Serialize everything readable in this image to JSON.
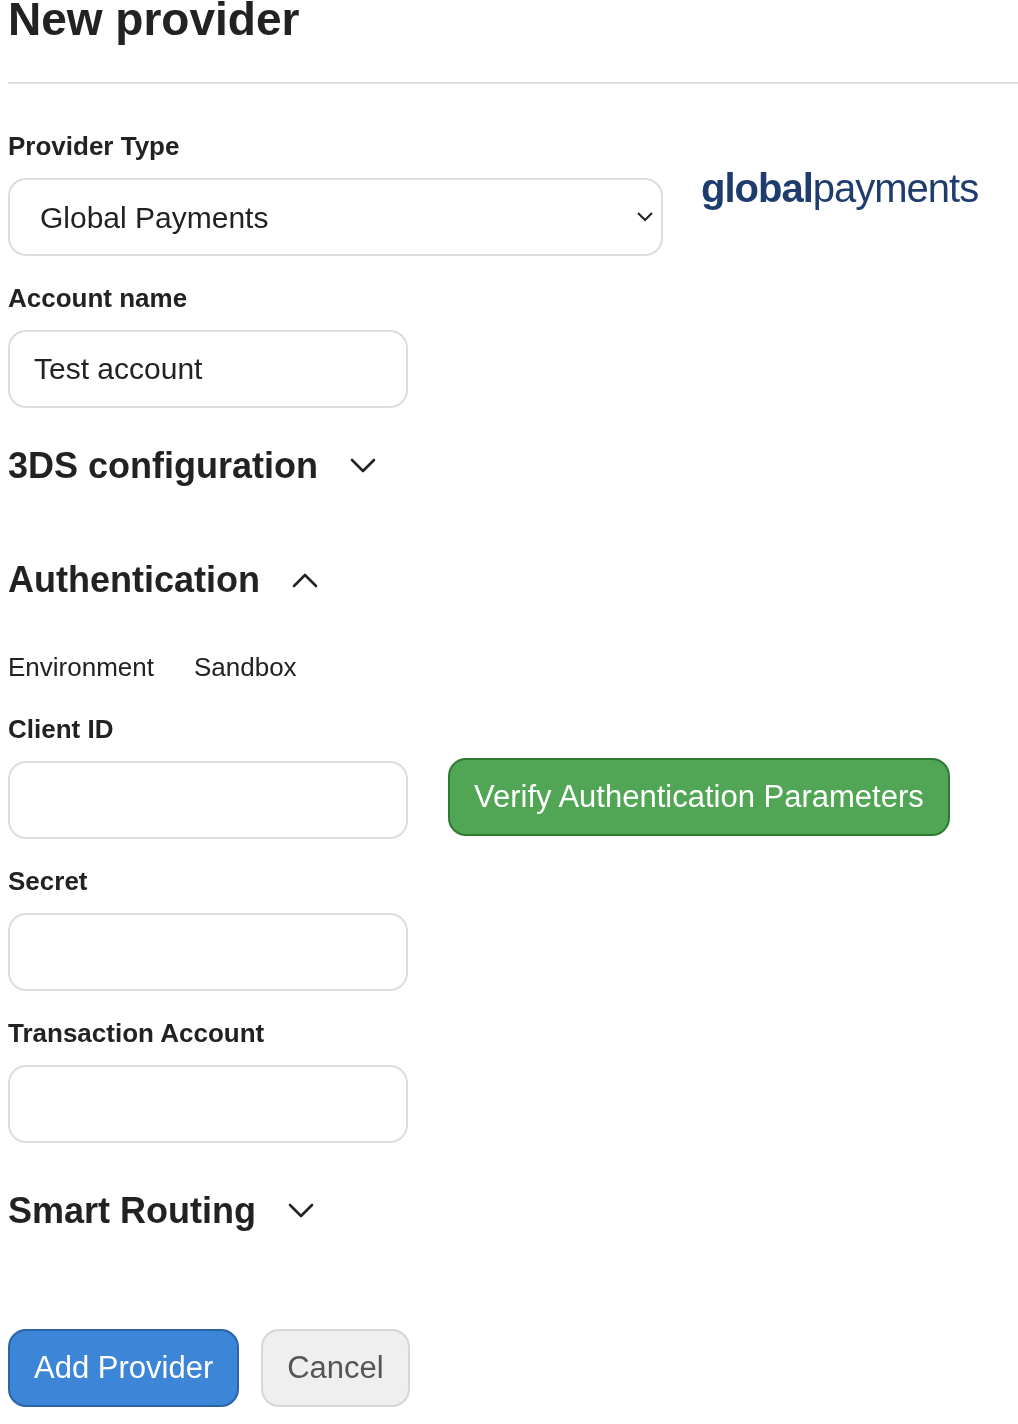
{
  "title": "New provider",
  "provider_type": {
    "label": "Provider Type",
    "value": "Global Payments",
    "logo": "**global**payments"
  },
  "account_name": {
    "label": "Account name",
    "value": "Test account"
  },
  "sections": [
    {
      "title": "3DS configuration",
      "expanded": false
    },
    {
      "title": "Authentication",
      "expanded": true
    }
  ],
  "environment": {
    "label": "Environment",
    "value": "Sandbox"
  },
  "fields": [
    {
      "label": "Client ID"
    },
    {
      "label": "Secret"
    },
    {
      "label": "Transaction Account"
    }
  ],
  "verify_button": "Verify Authentication Parameters",
  "smart_routing": {
    "title": "Smart Routing",
    "expanded": false
  },
  "buttons": [
    {
      "label": "Add Provider",
      "kind": "primary"
    },
    {
      "label": "Cancel",
      "kind": "secondary"
    }
  ]
}
